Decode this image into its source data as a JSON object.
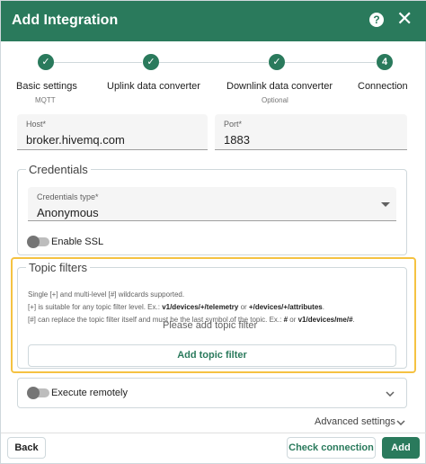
{
  "header": {
    "title": "Add Integration",
    "help_glyph": "?",
    "close_glyph": "✕"
  },
  "stepper": {
    "steps": [
      {
        "marker": "✓",
        "label": "Basic settings",
        "sub": "MQTT"
      },
      {
        "marker": "✓",
        "label": "Uplink data converter",
        "sub": ""
      },
      {
        "marker": "✓",
        "label": "Downlink data converter",
        "sub": "Optional"
      },
      {
        "marker": "4",
        "label": "Connection",
        "sub": ""
      }
    ]
  },
  "connection": {
    "host_label": "Host*",
    "host_value": "broker.hivemq.com",
    "port_label": "Port*",
    "port_value": "1883"
  },
  "credentials": {
    "legend": "Credentials",
    "type_label": "Credentials type*",
    "type_value": "Anonymous",
    "ssl_label": "Enable SSL"
  },
  "topic_filters": {
    "legend": "Topic filters",
    "hint_line1": "Single [+] and multi-level [#] wildcards supported.",
    "hint_line2_a": "[+] is suitable for any topic filter level. Ex.: ",
    "hint_line2_b": "v1/devices/+/telemetry",
    "hint_line2_c": " or ",
    "hint_line2_d": "+/devices/+/attributes",
    "hint_line2_e": ".",
    "hint_line3_a": "[#] can replace the topic filter itself and must be the last symbol of the topic. Ex.: ",
    "hint_line3_b": "#",
    "hint_line3_c": " or ",
    "hint_line3_d": "v1/devices/me/#",
    "hint_line3_e": ".",
    "empty_text": "Please add topic filter",
    "add_button": "Add topic filter"
  },
  "execute_remotely": {
    "label": "Execute remotely"
  },
  "advanced": {
    "label": "Advanced settings"
  },
  "footer": {
    "back": "Back",
    "check": "Check connection",
    "add": "Add"
  },
  "colors": {
    "primary": "#2a7a5c",
    "highlight": "#f5c242"
  },
  "icons": [
    "help-icon",
    "close-icon",
    "check-icon",
    "dropdown-arrow-icon",
    "chevron-down-icon",
    "toggle-icon"
  ]
}
